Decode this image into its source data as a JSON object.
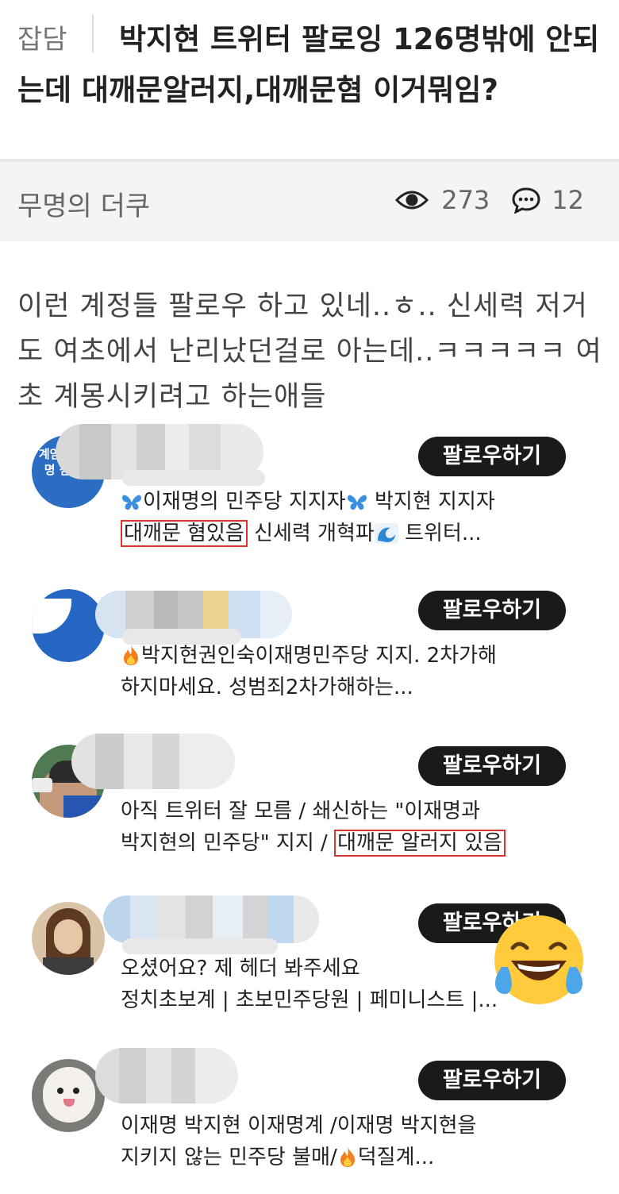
{
  "post": {
    "category": "잡담",
    "title": "박지현 트위터 팔로잉 126명밖에 안되는데 대깨문알러지,대깨문혐 이거뭐임?",
    "author": "무명의 더쿠",
    "views": "273",
    "comments": "12",
    "body": "이런 계정들 팔로우 하고 있네..ㅎ.. 신세력 저거도 여초에서 난리났던걸로 아는데..ㅋㅋㅋㅋㅋ 여초 계몽시키려고 하는애들"
  },
  "accounts": [
    {
      "follow_label": "팔로우하기",
      "avatar_text": "계엄을 이재명 심어라",
      "bio_line1": "이재명의 민주당 지지자",
      "bio_line1b": "박지현 지지자",
      "bio_highlight": "대깨문 혐있음",
      "bio_line2_rest": "신세력 개혁파",
      "bio_line2_end": "트위터..."
    },
    {
      "follow_label": "팔로우하기",
      "bio_line1": "박지현권인숙이재명민주당 지지. 2차가해",
      "bio_line2": "하지마세요. 성범죄2차가해하는..."
    },
    {
      "follow_label": "팔로우하기",
      "bio_line1": "아직 트위터 잘 모름 / 쇄신하는 \"이재명과",
      "bio_line2_start": "박지현의 민주당\" 지지 / ",
      "bio_highlight": "대깨문 알러지 있음"
    },
    {
      "follow_label": "팔로우하기",
      "bio_line1": "오셨어요? 제 헤더 봐주세요",
      "bio_line2": "정치초보계 | 초보민주당원  | 페미니스트 |..."
    },
    {
      "follow_label": "팔로우하기",
      "bio_line1": "이재명 박지현 이재명계 /이재명 박지현을",
      "bio_line2_start": "지키지 않는 민주당 불매/",
      "bio_line2_end": "덕질계..."
    }
  ],
  "icons": [
    "eye-icon",
    "comment-icon",
    "butterfly-icon",
    "wave-icon",
    "fire-icon",
    "laughing-tears-emoji"
  ],
  "colors": {
    "highlight_border": "#d9322e",
    "button_bg": "#1a1a1a"
  }
}
